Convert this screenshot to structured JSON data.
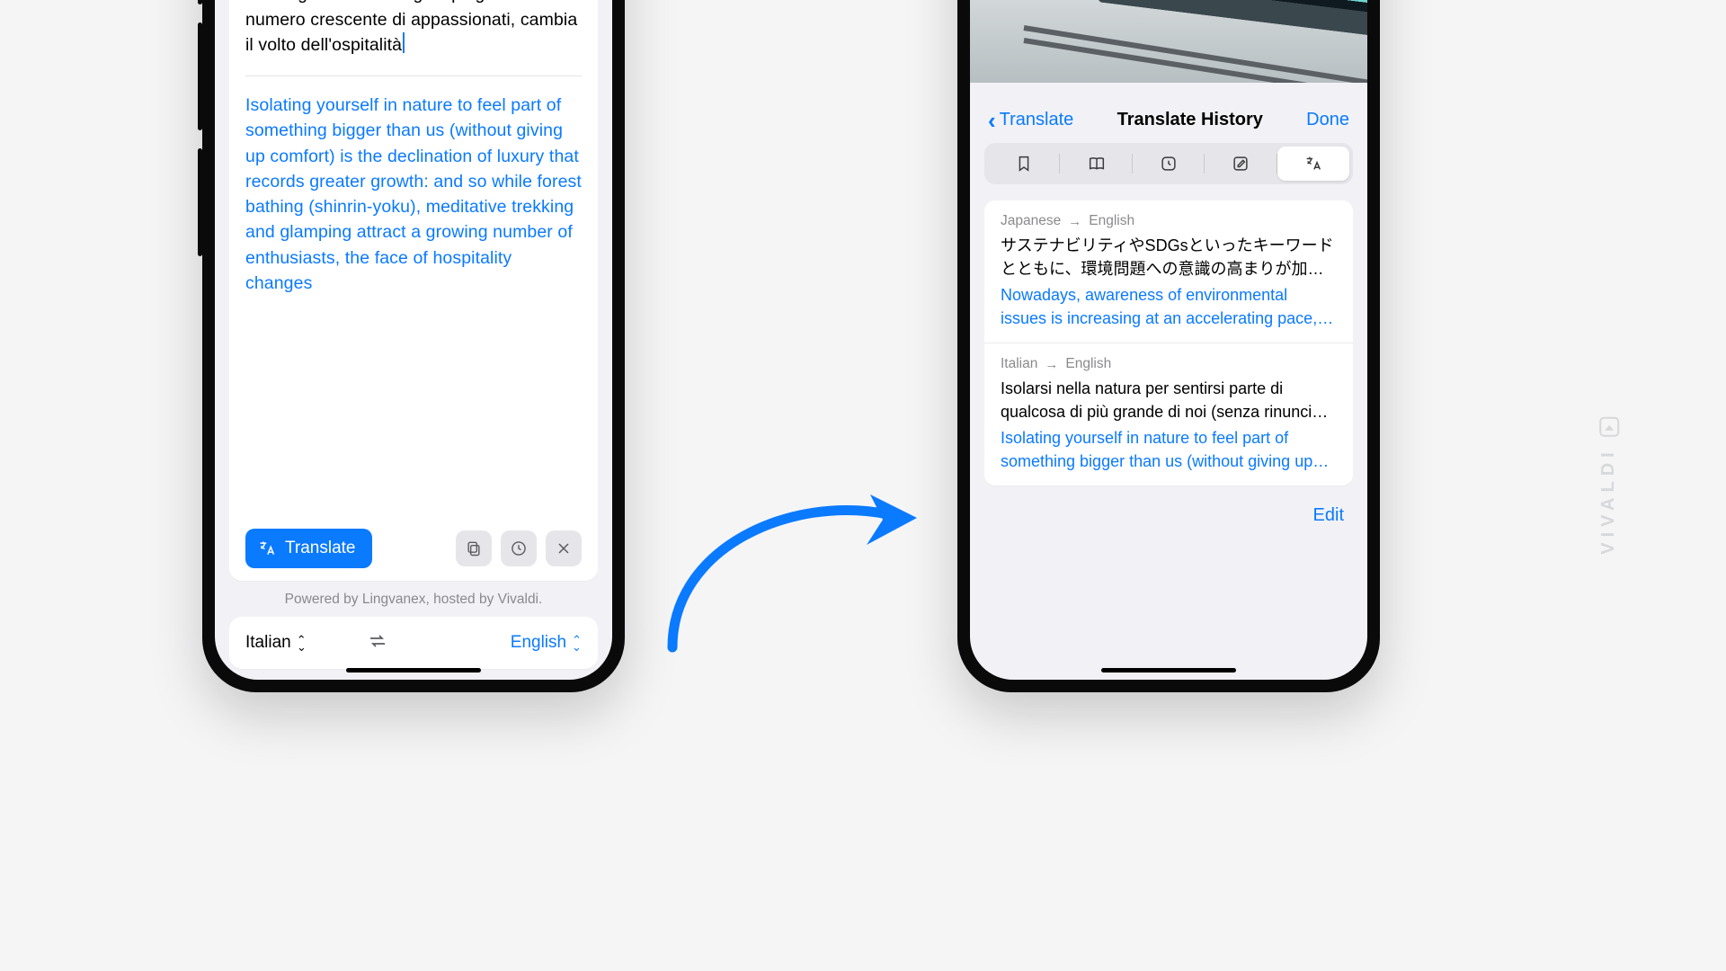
{
  "colors": {
    "accent": "#0a7aff"
  },
  "left": {
    "source_text": "Isolarsi nella natura per sentirsi parte di qualcosa di più grande di noi (senza rinunciare al comfort) è la declinazione del lusso che registra maggiori crescite: e così mentre forest bathing (shinrin-yoku), trekking meditativo e glamping attirano un numero crescente di appassionati, cambia il volto dell'ospitalità",
    "target_text": "Isolating yourself in nature to feel part of something bigger than us (without giving up comfort) is the declination of luxury that records greater growth: and so while forest bathing (shinrin-yoku), meditative trekking and glamping attract a growing number of enthusiasts, the face of hospitality changes",
    "translate_button": "Translate",
    "powered_by": "Powered by Lingvanex, hosted by Vivaldi.",
    "lang_source": "Italian",
    "lang_target": "English"
  },
  "right": {
    "back_label": "Translate",
    "title": "Translate History",
    "done_label": "Done",
    "edit_label": "Edit",
    "segments": [
      "bookmark",
      "read",
      "history",
      "note",
      "translate"
    ],
    "active_segment": 4,
    "items": [
      {
        "src_lang": "Japanese",
        "tgt_lang": "English",
        "src_text": "サステナビリティやSDGsといったキーワードとともに、環境問題への意識の高まりが加速度…",
        "tgt_text": "Nowadays, awareness of environmental issues is increasing at an accelerating pace,…"
      },
      {
        "src_lang": "Italian",
        "tgt_lang": "English",
        "src_text": "Isolarsi nella natura per sentirsi parte di qualcosa di più grande di noi (senza rinunci…",
        "tgt_text": "Isolating yourself in nature to feel part of something bigger than us (without giving up…"
      }
    ]
  },
  "brand": "VIVALDI"
}
